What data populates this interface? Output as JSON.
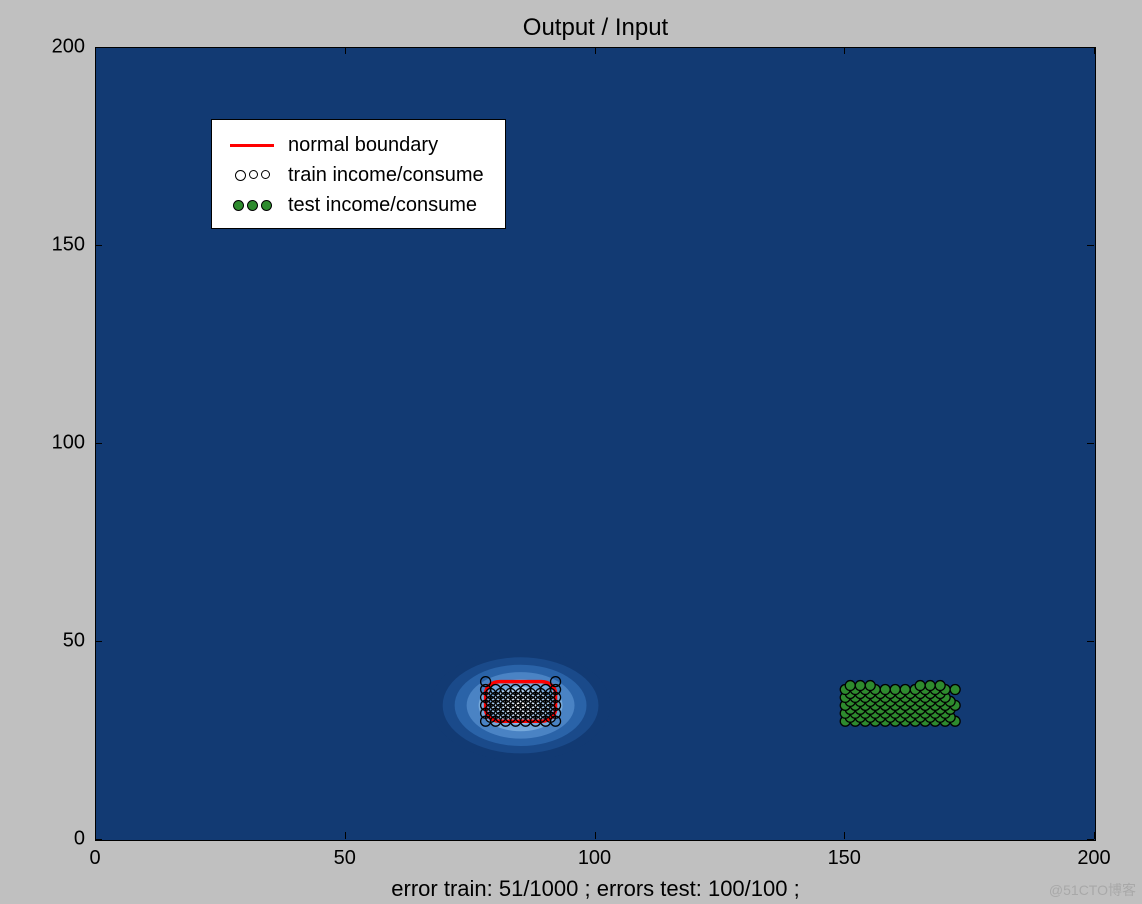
{
  "chart_data": {
    "type": "scatter",
    "title": "Output / Input",
    "xlabel": "error train: 51/1000 ; errors test: 100/100 ;",
    "ylabel": "",
    "xlim": [
      0,
      200
    ],
    "ylim": [
      0,
      200
    ],
    "x_ticks": [
      0,
      50,
      100,
      150,
      200
    ],
    "y_ticks": [
      0,
      50,
      100,
      150,
      200
    ],
    "background_color": "#123a73",
    "density_contour": {
      "center": [
        85,
        34
      ],
      "levels": 8,
      "x_extent": [
        67,
        103
      ],
      "y_extent": [
        20,
        48
      ],
      "colormap_low": "#ffffff",
      "colormap_high": "#123a73"
    },
    "boundary": {
      "color": "#ff0000",
      "shape": "rounded-rect",
      "x_range": [
        78,
        92
      ],
      "y_range": [
        30,
        40
      ]
    },
    "series": [
      {
        "name": "normal boundary",
        "render": "line",
        "color": "#ff0000"
      },
      {
        "name": "train income/consume",
        "render": "open-circle",
        "edge": "#000000",
        "fill": "none",
        "points": [
          [
            78,
            30
          ],
          [
            80,
            30
          ],
          [
            82,
            30
          ],
          [
            84,
            30
          ],
          [
            86,
            30
          ],
          [
            88,
            30
          ],
          [
            90,
            30
          ],
          [
            92,
            30
          ],
          [
            78,
            32
          ],
          [
            80,
            32
          ],
          [
            82,
            32
          ],
          [
            84,
            32
          ],
          [
            86,
            32
          ],
          [
            88,
            32
          ],
          [
            90,
            32
          ],
          [
            92,
            32
          ],
          [
            78,
            34
          ],
          [
            80,
            34
          ],
          [
            82,
            34
          ],
          [
            84,
            34
          ],
          [
            86,
            34
          ],
          [
            88,
            34
          ],
          [
            90,
            34
          ],
          [
            92,
            34
          ],
          [
            78,
            36
          ],
          [
            80,
            36
          ],
          [
            82,
            36
          ],
          [
            84,
            36
          ],
          [
            86,
            36
          ],
          [
            88,
            36
          ],
          [
            90,
            36
          ],
          [
            92,
            36
          ],
          [
            78,
            38
          ],
          [
            80,
            38
          ],
          [
            82,
            38
          ],
          [
            84,
            38
          ],
          [
            86,
            38
          ],
          [
            88,
            38
          ],
          [
            90,
            38
          ],
          [
            92,
            38
          ],
          [
            79,
            31
          ],
          [
            81,
            31
          ],
          [
            83,
            31
          ],
          [
            85,
            31
          ],
          [
            87,
            31
          ],
          [
            89,
            31
          ],
          [
            91,
            31
          ],
          [
            79,
            33
          ],
          [
            81,
            33
          ],
          [
            83,
            33
          ],
          [
            85,
            33
          ],
          [
            87,
            33
          ],
          [
            89,
            33
          ],
          [
            91,
            33
          ],
          [
            79,
            35
          ],
          [
            81,
            35
          ],
          [
            83,
            35
          ],
          [
            85,
            35
          ],
          [
            87,
            35
          ],
          [
            89,
            35
          ],
          [
            91,
            35
          ],
          [
            79,
            37
          ],
          [
            81,
            37
          ],
          [
            83,
            37
          ],
          [
            85,
            37
          ],
          [
            87,
            37
          ],
          [
            89,
            37
          ],
          [
            91,
            37
          ],
          [
            78,
            40
          ],
          [
            92,
            40
          ]
        ]
      },
      {
        "name": "test income/consume",
        "render": "filled-circle",
        "edge": "#000000",
        "fill": "#2e8b2e",
        "points": [
          [
            150,
            30
          ],
          [
            152,
            30
          ],
          [
            154,
            30
          ],
          [
            156,
            30
          ],
          [
            158,
            30
          ],
          [
            160,
            30
          ],
          [
            162,
            30
          ],
          [
            164,
            30
          ],
          [
            166,
            30
          ],
          [
            168,
            30
          ],
          [
            170,
            30
          ],
          [
            172,
            30
          ],
          [
            151,
            31
          ],
          [
            153,
            31
          ],
          [
            155,
            31
          ],
          [
            157,
            31
          ],
          [
            159,
            31
          ],
          [
            161,
            31
          ],
          [
            163,
            31
          ],
          [
            165,
            31
          ],
          [
            167,
            31
          ],
          [
            169,
            31
          ],
          [
            171,
            31
          ],
          [
            150,
            32
          ],
          [
            152,
            32
          ],
          [
            154,
            32
          ],
          [
            156,
            32
          ],
          [
            158,
            32
          ],
          [
            160,
            32
          ],
          [
            162,
            32
          ],
          [
            164,
            32
          ],
          [
            166,
            32
          ],
          [
            168,
            32
          ],
          [
            170,
            32
          ],
          [
            151,
            33
          ],
          [
            153,
            33
          ],
          [
            155,
            33
          ],
          [
            157,
            33
          ],
          [
            159,
            33
          ],
          [
            161,
            33
          ],
          [
            163,
            33
          ],
          [
            165,
            33
          ],
          [
            167,
            33
          ],
          [
            169,
            33
          ],
          [
            171,
            33
          ],
          [
            150,
            34
          ],
          [
            152,
            34
          ],
          [
            154,
            34
          ],
          [
            156,
            34
          ],
          [
            158,
            34
          ],
          [
            160,
            34
          ],
          [
            162,
            34
          ],
          [
            164,
            34
          ],
          [
            166,
            34
          ],
          [
            168,
            34
          ],
          [
            170,
            34
          ],
          [
            172,
            34
          ],
          [
            151,
            35
          ],
          [
            153,
            35
          ],
          [
            155,
            35
          ],
          [
            157,
            35
          ],
          [
            159,
            35
          ],
          [
            161,
            35
          ],
          [
            163,
            35
          ],
          [
            165,
            35
          ],
          [
            167,
            35
          ],
          [
            169,
            35
          ],
          [
            171,
            35
          ],
          [
            150,
            36
          ],
          [
            152,
            36
          ],
          [
            154,
            36
          ],
          [
            156,
            36
          ],
          [
            158,
            36
          ],
          [
            160,
            36
          ],
          [
            162,
            36
          ],
          [
            164,
            36
          ],
          [
            166,
            36
          ],
          [
            168,
            36
          ],
          [
            170,
            36
          ],
          [
            151,
            37
          ],
          [
            153,
            37
          ],
          [
            155,
            37
          ],
          [
            157,
            37
          ],
          [
            159,
            37
          ],
          [
            161,
            37
          ],
          [
            163,
            37
          ],
          [
            165,
            37
          ],
          [
            167,
            37
          ],
          [
            169,
            37
          ],
          [
            150,
            38
          ],
          [
            152,
            38
          ],
          [
            154,
            38
          ],
          [
            156,
            38
          ],
          [
            158,
            38
          ],
          [
            160,
            38
          ],
          [
            162,
            38
          ],
          [
            164,
            38
          ],
          [
            166,
            38
          ],
          [
            168,
            38
          ],
          [
            170,
            38
          ],
          [
            172,
            38
          ],
          [
            151,
            39
          ],
          [
            153,
            39
          ],
          [
            155,
            39
          ],
          [
            165,
            39
          ],
          [
            167,
            39
          ],
          [
            169,
            39
          ]
        ]
      }
    ],
    "legend": {
      "position": "upper-left",
      "entries": [
        {
          "label": "normal boundary",
          "kind": "line",
          "color": "#ff0000"
        },
        {
          "label": "train income/consume",
          "kind": "open-circle",
          "color": "#000000"
        },
        {
          "label": "test income/consume",
          "kind": "filled-circle",
          "color": "#2e8b2e"
        }
      ]
    }
  },
  "watermark": "@51CTO博客"
}
